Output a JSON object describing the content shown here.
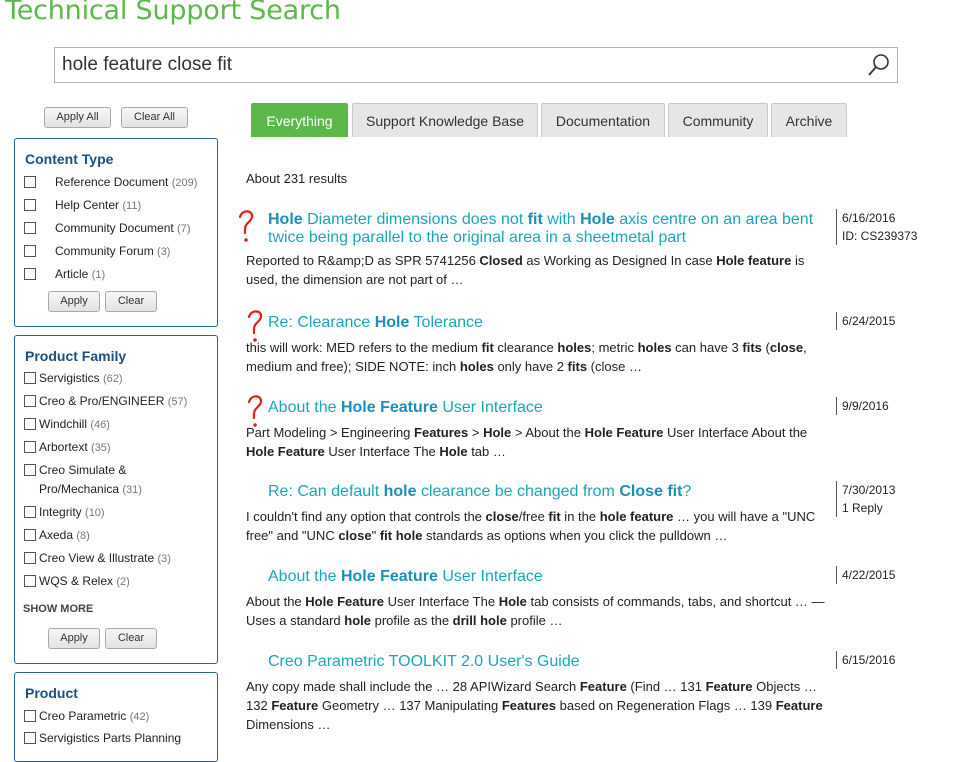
{
  "page": {
    "title": "Technical Support Search",
    "search_value": "hole feature close fit",
    "search_icon": "magnifier-icon"
  },
  "filters": {
    "apply_all": "Apply All",
    "clear_all": "Clear All",
    "content_type": {
      "title": "Content Type",
      "items": [
        {
          "label": "Reference Document",
          "count": "(209)"
        },
        {
          "label": "Help Center",
          "count": "(11)"
        },
        {
          "label": "Community Document",
          "count": "(7)"
        },
        {
          "label": "Community Forum",
          "count": "(3)"
        },
        {
          "label": "Article",
          "count": "(1)"
        }
      ],
      "apply": "Apply",
      "clear": "Clear"
    },
    "product_family": {
      "title": "Product Family",
      "items": [
        {
          "label": "Servigistics",
          "count": "(62)"
        },
        {
          "label": "Creo & Pro/ENGINEER",
          "count": "(57)"
        },
        {
          "label": "Windchill",
          "count": "(46)"
        },
        {
          "label": "Arbortext",
          "count": "(35)"
        },
        {
          "label": "Creo Simulate &",
          "label2": "Pro/Mechanica",
          "count": "(31)"
        },
        {
          "label": "Integrity",
          "count": "(10)"
        },
        {
          "label": "Axeda",
          "count": "(8)"
        },
        {
          "label": "Creo View & Illustrate",
          "count": "(3)"
        },
        {
          "label": "WQS & Relex",
          "count": "(2)"
        }
      ],
      "show_more": "SHOW MORE",
      "apply": "Apply",
      "clear": "Clear"
    },
    "product": {
      "title": "Product",
      "items": [
        {
          "label": "Creo Parametric",
          "count": "(42)"
        },
        {
          "label": "Servigistics Parts Planning",
          "count": ""
        }
      ]
    }
  },
  "tabs": [
    "Everything",
    "Support Knowledge Base",
    "Documentation",
    "Community",
    "Archive"
  ],
  "results_count": "About 231 results",
  "results": [
    {
      "title_html": "<b>Hole</b> Diameter dimensions does not <b>fit</b> with <b>Hole</b> axis centre on an area bent twice being parallel to the original area in a sheetmetal part",
      "snippet_html": "Reported to R&amp;amp;D as SPR 5741256 <b>Closed</b> as Working as Designed In case <b>Hole feature</b> is used, the dimension are not part of …",
      "date": "6/16/2016",
      "extra": "ID: CS239373",
      "marked": true
    },
    {
      "title_html": "Re: Clearance <b>Hole</b> Tolerance",
      "snippet_html": "this will work: MED refers to the medium <b>fit</b> clearance <b>holes</b>; metric <b>holes</b> can have 3 <b>fits</b> (<b>close</b>, medium and free); SIDE NOTE: inch <b>holes</b> only have 2 <b>fits</b> (close …",
      "date": "6/24/2015",
      "extra": "",
      "marked": true
    },
    {
      "title_html": "About the <b>Hole Feature</b> User Interface",
      "snippet_html": "Part Modeling &gt; Engineering <b>Features</b> &gt; <b>Hole</b> &gt; About the <b>Hole Feature</b> User Interface About the <b>Hole Feature</b> User Interface The <b>Hole</b> tab …",
      "date": "9/9/2016",
      "extra": "",
      "marked": true
    },
    {
      "title_html": "Re: Can default <b>hole</b> clearance be changed from <b>Close fit</b>?",
      "snippet_html": "I couldn't find any option that controls the <b>close</b>/free <b>fit</b> in the <b>hole feature</b> … you will have a \"UNC free\" and \"UNC <b>close</b>\" <b>fit hole</b> standards as options when you click the pulldown …",
      "date": "7/30/2013",
      "extra": "1 Reply",
      "marked": false
    },
    {
      "title_html": "About the <b>Hole Feature</b> User Interface",
      "snippet_html": "About the <b>Hole Feature</b> User Interface The <b>Hole</b> tab consists of commands, tabs, and shortcut … —Uses a standard <b>hole</b> profile as the <b>drill hole</b> profile …",
      "date": "4/22/2015",
      "extra": "",
      "marked": false
    },
    {
      "title_html": "Creo Parametric TOOLKIT 2.0 User's Guide",
      "snippet_html": "Any copy made shall include the … 28 APIWizard Search <b>Feature</b> (Find … 131 <b>Feature</b> Objects … 132 <b>Feature</b> Geometry … 137 Manipulating <b>Features</b> based on Regeneration Flags … 139 <b>Feature</b> Dimensions …",
      "date": "6/15/2016",
      "extra": "",
      "marked": false
    }
  ],
  "colors": {
    "brand_green": "#5cb84a",
    "link": "#1aa6b7",
    "facet_title": "#1b4f83",
    "annotation_red": "#e0201b"
  }
}
